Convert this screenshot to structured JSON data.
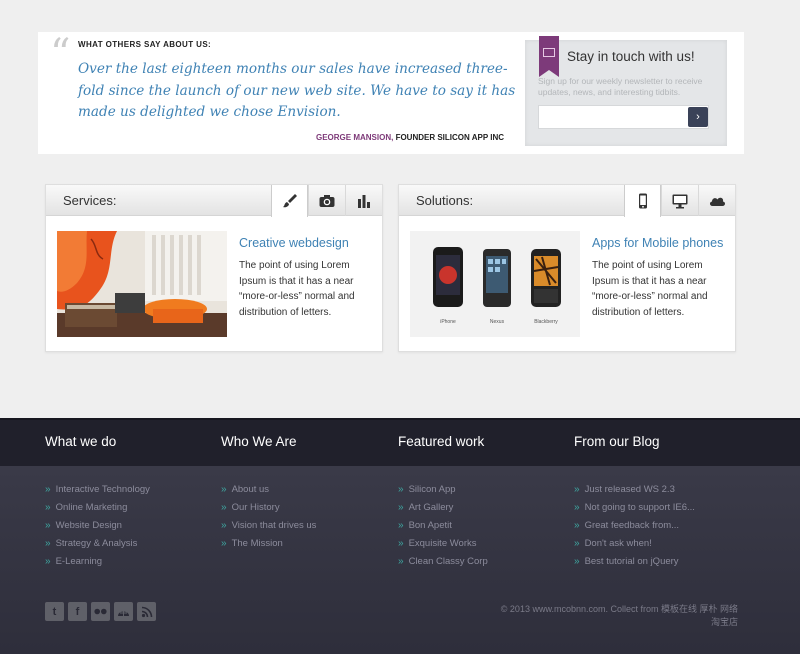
{
  "testimonial": {
    "heading": "WHAT OTHERS SAY ABOUT US:",
    "quote": "Over the last eighteen months our sales have increased three-fold since the launch of our new web site. We have to say it has made us delighted we chose Envision.",
    "author_name": "GEORGE MANSION,",
    "author_title": " FOUNDER SILICON APP INC"
  },
  "newsletter": {
    "title": "Stay in touch with us!",
    "text": "Sign up for our weekly newsletter to receive updates, news, and interesting tidbits.",
    "input_value": "",
    "submit_label": "›"
  },
  "services": {
    "title": "Services:",
    "tabs": [
      "brush-icon",
      "camera-icon",
      "bar-chart-icon"
    ],
    "active_tab": 0,
    "heading": "Creative webdesign",
    "text": "The point of using Lorem Ipsum is that it has a near “more-or-less” normal and distribution of letters."
  },
  "solutions": {
    "title": "Solutions:",
    "tabs": [
      "phone-icon",
      "monitor-icon",
      "cloud-icon"
    ],
    "active_tab": 0,
    "heading": "Apps for Mobile phones",
    "text": "The point of using Lorem Ipsum is that it has a near “more-or-less” normal and distribution of letters.",
    "phone_labels": [
      "iPhone",
      "Nexus",
      "Blackberry"
    ]
  },
  "footer": {
    "columns": [
      {
        "title": "What we do",
        "items": [
          "Interactive Technology",
          "Online Marketing",
          "Website Design",
          "Strategy & Analysis",
          "E-Learning"
        ]
      },
      {
        "title": "Who We Are",
        "items": [
          "About us",
          "Our History",
          "Vision that drives us",
          "The Mission"
        ]
      },
      {
        "title": "Featured work",
        "items": [
          "Silicon App",
          "Art Gallery",
          "Bon Apetit",
          "Exquisite Works",
          "Clean Classy Corp"
        ]
      },
      {
        "title": "From our Blog",
        "items": [
          "Just released WS 2.3",
          "Not going to support IE6...",
          "Great feedback from...",
          "Don't ask when!",
          "Best tutorial on jQuery"
        ]
      }
    ],
    "social": [
      "twitter-icon",
      "facebook-icon",
      "flickr-icon",
      "delicious-icon",
      "rss-icon"
    ],
    "copyright": "© 2013 www.mcobnn.com. Collect from 模板在线 厚朴 网络 淘宝店"
  },
  "colors": {
    "accent_blue": "#3f82b4",
    "accent_purple": "#7e3a79",
    "footer_dark": "#2a2a36",
    "footer_link_arrow": "#3ea6a0"
  }
}
